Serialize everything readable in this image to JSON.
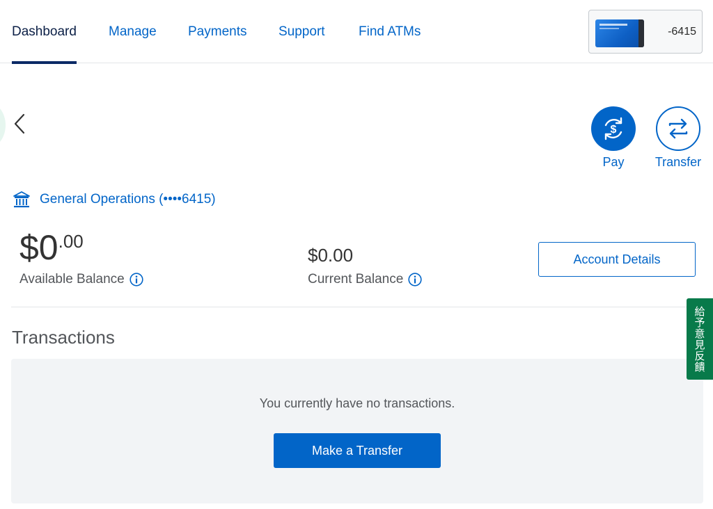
{
  "nav": {
    "tabs": [
      {
        "label": "Dashboard",
        "active": true
      },
      {
        "label": "Manage",
        "active": false
      },
      {
        "label": "Payments",
        "active": false
      },
      {
        "label": "Support",
        "active": false
      },
      {
        "label": "Find ATMs",
        "active": false
      }
    ],
    "card_switcher": {
      "last4": "-6415"
    }
  },
  "actions": {
    "pay_label": "Pay",
    "transfer_label": "Transfer"
  },
  "account": {
    "name": "General Operations (••••6415)",
    "available_balance": {
      "whole": "$0",
      "cents": ".00",
      "label": "Available Balance"
    },
    "current_balance": {
      "amount": "$0.00",
      "label": "Current Balance"
    },
    "details_button": "Account Details"
  },
  "transactions": {
    "heading": "Transactions",
    "empty_message": "You currently have no transactions.",
    "make_transfer_button": "Make a Transfer"
  },
  "feedback": {
    "label": "給予意見反饋"
  },
  "colors": {
    "accent": "#0265c8",
    "nav_active": "#0b2a66",
    "feedback_green": "#087a4a",
    "panel_bg": "#f2f4f6"
  },
  "icons": [
    "chevron-left-icon",
    "pay-dollar-cycle-icon",
    "transfer-arrows-icon",
    "bank-icon",
    "info-icon",
    "amex-card-icon"
  ]
}
